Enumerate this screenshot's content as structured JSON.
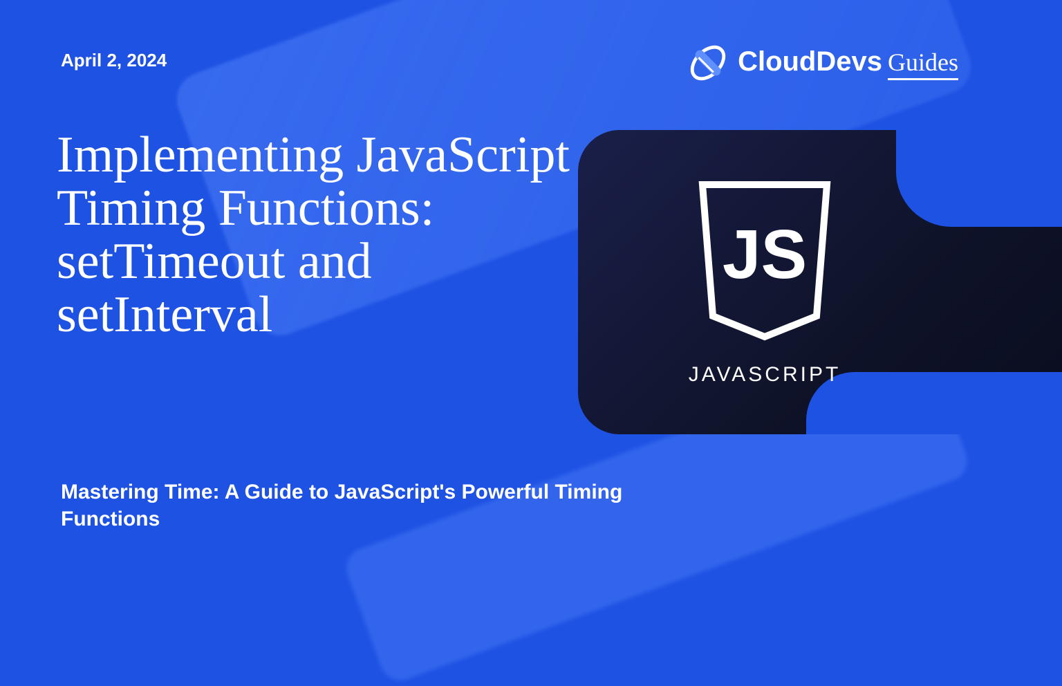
{
  "date": "April 2, 2024",
  "title": "Implementing JavaScript Timing Functions: setTimeout and setInterval",
  "subtitle": "Mastering Time: A Guide to JavaScript's Powerful Timing Functions",
  "brand": {
    "name": "CloudDevs",
    "suffix": "Guides"
  },
  "card": {
    "technology": "JAVASCRIPT",
    "shield_text": "JS"
  },
  "colors": {
    "background": "#1e52e3",
    "card_gradient_start": "#1a1f4a",
    "card_gradient_end": "#0a0d1f"
  }
}
